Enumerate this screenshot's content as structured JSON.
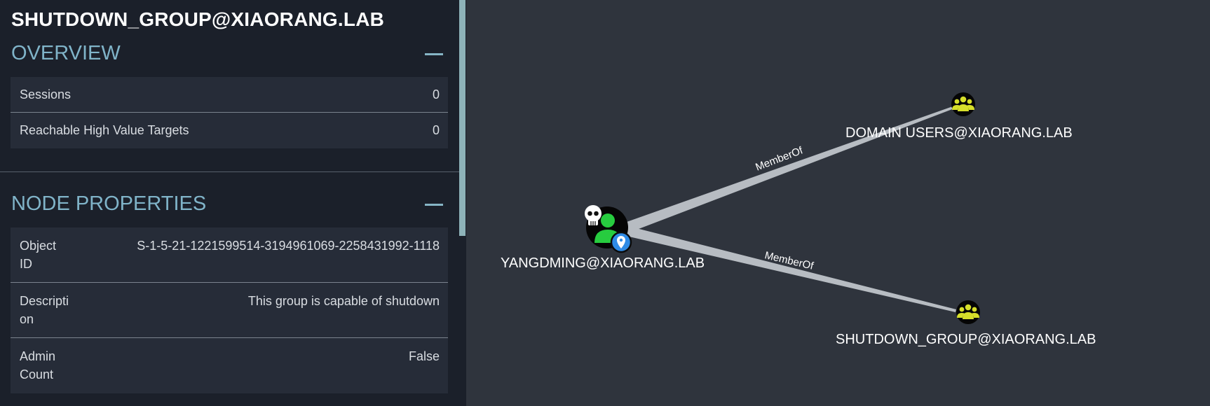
{
  "panel": {
    "node_title": "SHUTDOWN_GROUP@XIAORANG.LAB",
    "overview": {
      "heading": "OVERVIEW",
      "rows": [
        {
          "label": "Sessions",
          "value": "0"
        },
        {
          "label": "Reachable High Value Targets",
          "value": "0"
        }
      ]
    },
    "node_properties": {
      "heading": "NODE PROPERTIES",
      "rows": [
        {
          "label_line1": "Object",
          "label_line2": "ID",
          "value": "S-1-5-21-1221599514-3194961069-2258431992-1118"
        },
        {
          "label_line1": "Descripti",
          "label_line2": "on",
          "value": "This group is capable of shutdown"
        },
        {
          "label_line1": "Admin",
          "label_line2": "Count",
          "value": "False"
        }
      ]
    }
  },
  "graph": {
    "nodes": {
      "user": {
        "label": "YANGDMING@XIAORANG.LAB",
        "icon": "user-icon",
        "badges": [
          "skull-icon",
          "location-pin-icon"
        ]
      },
      "domain_users": {
        "label": "DOMAIN USERS@XIAORANG.LAB",
        "icon": "group-icon"
      },
      "shutdown_group": {
        "label": "SHUTDOWN_GROUP@XIAORANG.LAB",
        "icon": "group-icon"
      }
    },
    "edges": [
      {
        "from": "user",
        "to": "domain_users",
        "label": "MemberOf"
      },
      {
        "from": "user",
        "to": "shutdown_group",
        "label": "MemberOf"
      }
    ]
  },
  "colors": {
    "panel_bg": "#1b202a",
    "graph_bg": "#2f343d",
    "heading": "#80b4c9",
    "user_node": "#22cc44",
    "group_node": "#d6df2a",
    "pin": "#2e8be6"
  }
}
